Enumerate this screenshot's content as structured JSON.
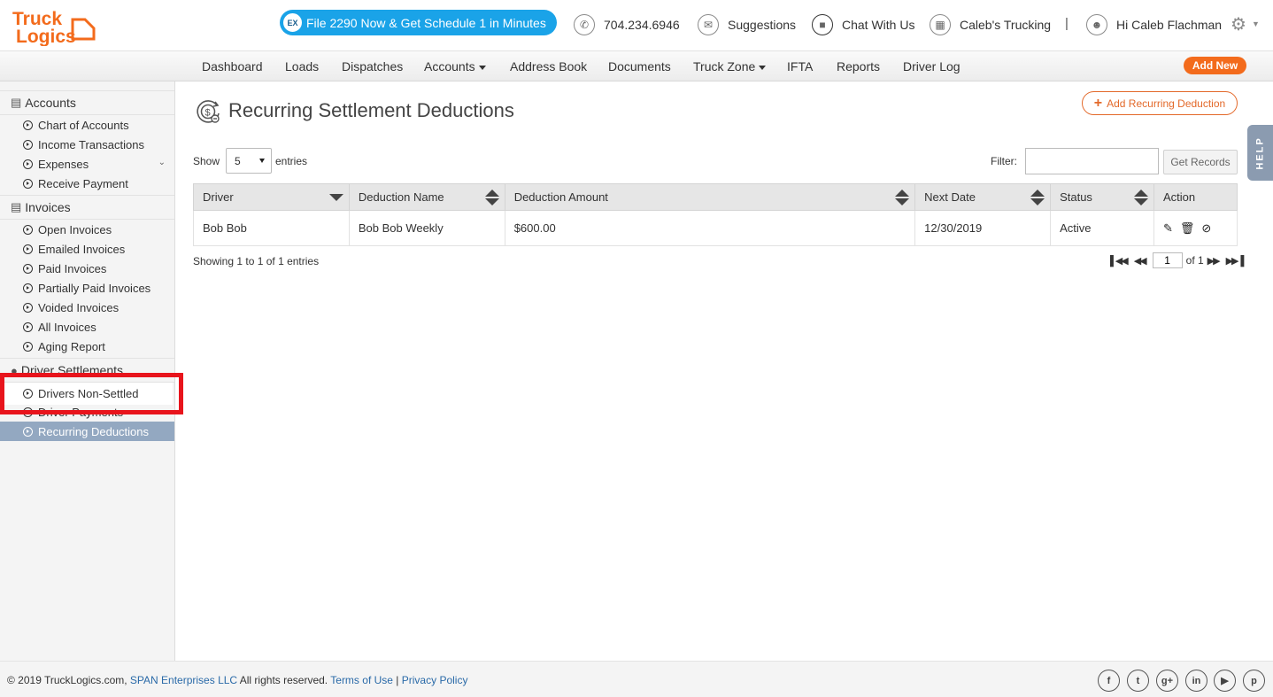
{
  "header": {
    "logo_line1": "Truck",
    "logo_line2": "Logics",
    "promo_badge": "EX",
    "promo_text": "File 2290 Now & Get Schedule 1 in Minutes",
    "phone": "704.234.6946",
    "suggestions": "Suggestions",
    "chat": "Chat With Us",
    "company": "Caleb's Trucking",
    "separator": "|",
    "greeting": "Hi Caleb Flachman"
  },
  "nav": {
    "items": [
      "Dashboard",
      "Loads",
      "Dispatches",
      "Accounts",
      "Address Book",
      "Documents",
      "Truck Zone",
      "IFTA",
      "Reports",
      "Driver Log"
    ],
    "add_new": "Add New"
  },
  "sidebar": {
    "accounts": {
      "label": "Accounts",
      "items": [
        "Chart of Accounts",
        "Income Transactions",
        "Expenses",
        "Receive Payment"
      ]
    },
    "invoices": {
      "label": "Invoices",
      "items": [
        "Open Invoices",
        "Emailed Invoices",
        "Paid Invoices",
        "Partially Paid Invoices",
        "Voided Invoices",
        "All Invoices",
        "Aging Report"
      ]
    },
    "settlements": {
      "label": "Driver Settlements",
      "items": [
        "Drivers Non-Settled",
        "Driver Payments",
        "Recurring Deductions"
      ]
    }
  },
  "main": {
    "title": "Recurring Settlement Deductions",
    "add_button": "Add Recurring Deduction",
    "help": "HELP",
    "show_label": "Show",
    "page_size": "5",
    "entries_label": "entries",
    "filter_label": "Filter:",
    "filter_value": "",
    "get_records": "Get Records",
    "columns": [
      "Driver",
      "Deduction Name",
      "Deduction Amount",
      "Next Date",
      "Status",
      "Action"
    ],
    "rows": [
      {
        "driver": "Bob Bob",
        "deduction_name": "Bob Bob Weekly",
        "amount": "$600.00",
        "next_date": "12/30/2019",
        "status": "Active"
      }
    ],
    "showing_text": "Showing 1 to 1 of 1 entries",
    "page_current": "1",
    "page_of": "of 1"
  },
  "footer": {
    "copyright": "© 2019 TruckLogics.com,",
    "company_link": "SPAN Enterprises LLC",
    "rights": "All rights reserved.",
    "terms": "Terms of Use",
    "divider": "|",
    "privacy": "Privacy Policy",
    "social": [
      "facebook-icon",
      "twitter-icon",
      "googleplus-icon",
      "linkedin-icon",
      "youtube-icon",
      "pinterest-icon"
    ]
  },
  "colors": {
    "brand_orange": "#f36b1c",
    "promo_blue": "#1aa3e8",
    "sidebar_active": "#93a8c1",
    "highlight_red": "#e8141c"
  }
}
